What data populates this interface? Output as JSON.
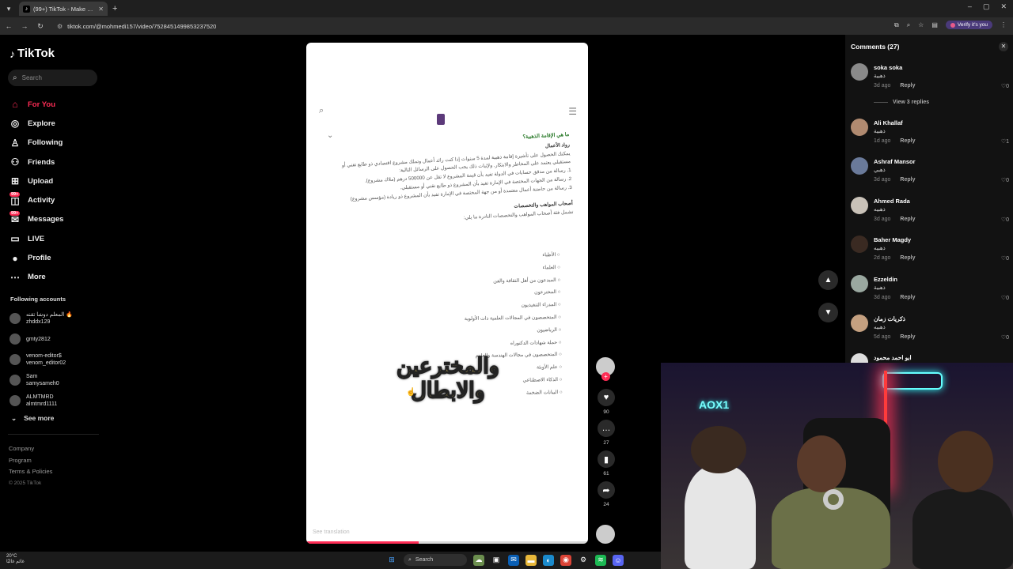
{
  "browser": {
    "tab_title": "(99+) TikTok - Make Your Day",
    "url": "tiktok.com/@mohmedi157/video/7528451499853237520",
    "verify_label": "Verify it's you"
  },
  "sidebar": {
    "logo": "TikTok",
    "search_placeholder": "Search",
    "nav": [
      {
        "label": "For You",
        "icon": "home-icon"
      },
      {
        "label": "Explore",
        "icon": "compass-icon"
      },
      {
        "label": "Following",
        "icon": "following-icon"
      },
      {
        "label": "Friends",
        "icon": "friends-icon"
      },
      {
        "label": "Upload",
        "icon": "upload-icon"
      },
      {
        "label": "Activity",
        "icon": "activity-icon",
        "badge": "99+"
      },
      {
        "label": "Messages",
        "icon": "messages-icon",
        "badge": "99+"
      },
      {
        "label": "LIVE",
        "icon": "live-icon"
      },
      {
        "label": "Profile",
        "icon": "profile-icon"
      },
      {
        "label": "More",
        "icon": "more-icon"
      }
    ],
    "following_title": "Following accounts",
    "accounts": [
      {
        "name": "المعلم دوشا تقنه 🔥",
        "handle": "zhddx129"
      },
      {
        "name": "gmty2812",
        "handle": ""
      },
      {
        "name": "venom-editor$",
        "handle": "venom_editor02"
      },
      {
        "name": "Sam",
        "handle": "samysameh0"
      },
      {
        "name": "ALMTMRD",
        "handle": "almtmrd1111"
      }
    ],
    "see_more": "See more",
    "footer": [
      "Company",
      "Program",
      "Terms & Policies"
    ],
    "copyright": "© 2025 TikTok"
  },
  "video": {
    "doc_heading": "ما هي الإقامة الذهبية؟",
    "doc_sub1": "رواد الأعمال",
    "doc_p1": "يمكنك الحصول على تأشيرة إقامة ذهبية لمدة 5 سنوات إذا كنت رائد أعمال وتملك مشروع اقتصادي ذو طابع تقني أو مستقبلي يعتمد على المخاطر والابتكار. ولإثبات ذلك يجب الحصول على الرسائل التالية:",
    "doc_p2": "1. رسالة من مدقق حسابات في الدولة تفيد بأن قيمة المشروع لا تقل عن 500000 درهم (ملاك مشروع).",
    "doc_p3": "2. رسالة من الجهات المختصة في الإمارة تفيد بأن المشروع ذو طابع تقني أو مستقبلي.",
    "doc_p4": "3. رسالة من حاضنة أعمال معتمدة أو من جهة المختصة في الإمارة تفيد بأن المشروع ذو ريادة (مؤسس مشروع)",
    "doc_sub2": "أصحاب المواهب والتخصصات",
    "doc_p5": "تشمل فئة أصحاب المواهب والتخصصات النادرة ما يلي:",
    "list": [
      "الأطباء",
      "العلماء",
      "المبدعون من أهل الثقافة والفن",
      "المخترعون",
      "المدراء التنفيذيون",
      "المتخصصون في المجالات العلمية ذات الأولوية",
      "الرياضيون",
      "حملة شهادات الدكتوراه",
      "المتخصصون في مجالات الهندسة والعلوم",
      "علم الأوبئة",
      "الذكاء الاصطناعي",
      "البيانات الضخمة"
    ],
    "overlay_text": "والمخترعين والابطال",
    "see_translation": "See translation"
  },
  "actions": {
    "likes": "90",
    "comments": "27",
    "saves": "61",
    "shares": "24"
  },
  "comments": {
    "title": "Comments (27)",
    "view_replies": "View 3 replies",
    "reply_label": "Reply",
    "items": [
      {
        "name": "soka soka",
        "text": "ذهبية",
        "date": "3d ago",
        "likes": "0"
      },
      {
        "name": "Ali Khallaf",
        "text": "ذهبية",
        "date": "1d ago",
        "likes": "1"
      },
      {
        "name": "Ashraf Mansor",
        "text": "ذهبي",
        "date": "3d ago",
        "likes": "0"
      },
      {
        "name": "Ahmed Rada",
        "text": "ذهبيه",
        "date": "3d ago",
        "likes": "0"
      },
      {
        "name": "Baher Magdy",
        "text": "ذهبيه",
        "date": "2d ago",
        "likes": "0"
      },
      {
        "name": "Ezzeldin",
        "text": "ذهبية",
        "date": "3d ago",
        "likes": "0"
      },
      {
        "name": "ذكريات زمان",
        "text": "ذهبيه",
        "date": "5d ago",
        "likes": "0"
      },
      {
        "name": "ابو احمد محمود",
        "text": "",
        "date": "",
        "likes": ""
      }
    ]
  },
  "webcam": {
    "sign": "AOX1"
  },
  "taskbar": {
    "temp": "20°C",
    "weather_text": "غائم غالبًا",
    "search": "Search"
  }
}
